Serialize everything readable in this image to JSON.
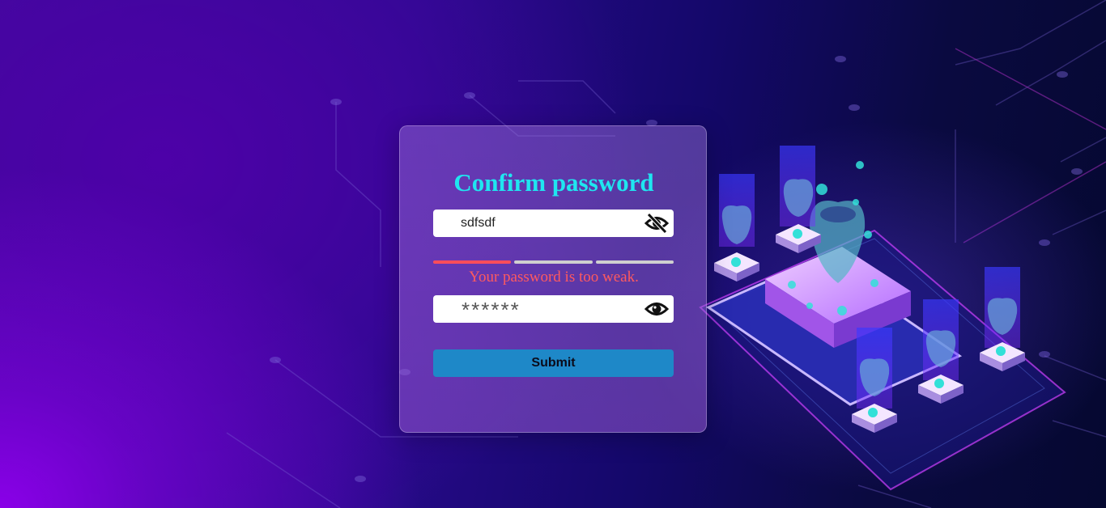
{
  "form": {
    "title": "Confirm password",
    "password": {
      "value": "sdfsdf",
      "toggle_icon": "eye-slash-icon"
    },
    "strength": {
      "level": 1,
      "total_segments": 3,
      "active_color": "#ff4d5a",
      "inactive_color": "#cfcfcf",
      "message": "Your password is too weak.",
      "message_color": "#ff5a5f"
    },
    "confirm_password": {
      "masked_value": "******",
      "toggle_icon": "eye-icon"
    },
    "submit_label": "Submit"
  },
  "colors": {
    "title": "#1fe6f0",
    "submit_bg": "#1e88c8"
  }
}
